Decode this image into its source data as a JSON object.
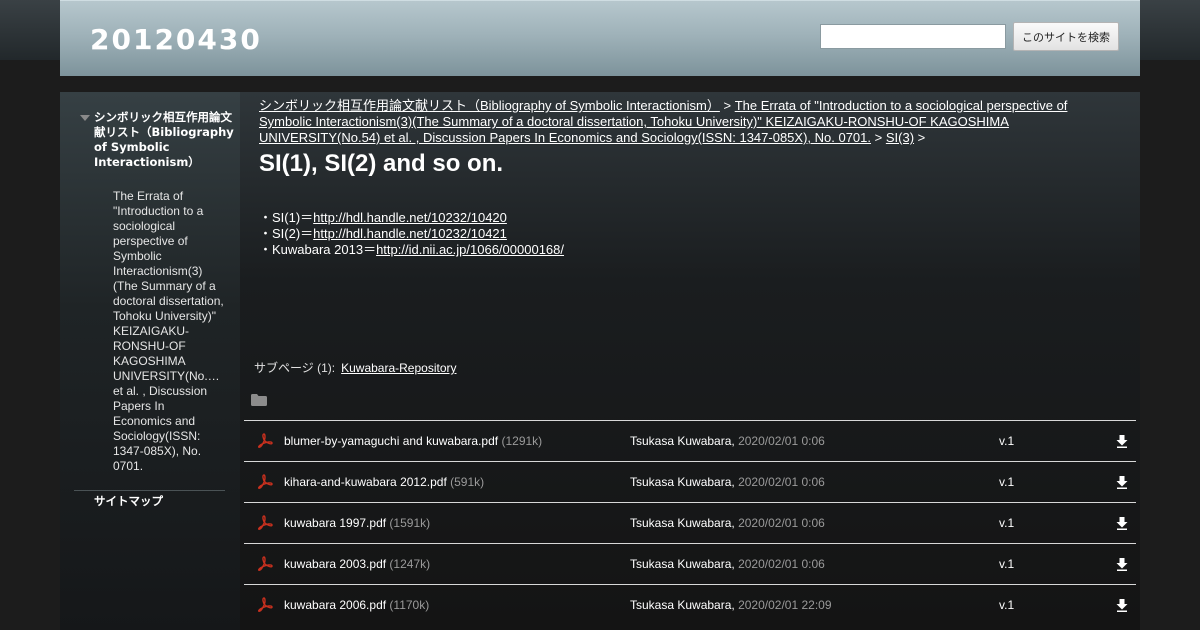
{
  "site": {
    "title": "20120430"
  },
  "search": {
    "placeholder": "",
    "button_label": "このサイトを検索"
  },
  "sidebar": {
    "top_item": "シンボリック相互作用論文献リスト（Bibliography of Symbolic Interactionism）",
    "sub_item": "The Errata of \"Introduction to a sociological perspective of Symbolic Interactionism(3)(The Summary of a doctoral dissertation, Tohoku University)\" KEIZAIGAKU-RONSHU-OF KAGOSHIMA UNIVERSITY(No.… et al. , Discussion Papers In Economics and Sociology(ISSN: 1347-085X), No. 0701.",
    "sitemap": "サイトマップ"
  },
  "breadcrumb": {
    "crumb1": "シンボリック相互作用論文献リスト（Bibliography of Symbolic Interactionism）",
    "sep": ">",
    "crumb2": "The Errata of \"Introduction to a sociological perspective of Symbolic Interactionism(3)(The Summary of a doctoral dissertation, Tohoku University)\" KEIZAIGAKU-RONSHU-OF KAGOSHIMA UNIVERSITY(No.54) et al. , Discussion Papers In Economics and Sociology(ISSN: 1347-085X), No. 0701.",
    "crumb3": "SI(3)"
  },
  "page": {
    "title": "SI(1), SI(2) and so on.",
    "lines": [
      {
        "prefix": "・SI(1)＝",
        "link": "http://hdl.handle.net/10232/10420"
      },
      {
        "prefix": "・SI(2)＝",
        "link": "http://hdl.handle.net/10232/10421"
      },
      {
        "prefix": "・Kuwabara 2013＝",
        "link": "http://id.nii.ac.jp/1066/00000168/"
      }
    ]
  },
  "subpages": {
    "label": "サブページ (1):",
    "link": "Kuwabara-Repository"
  },
  "files": [
    {
      "name": "blumer-by-yamaguchi and kuwabara.pdf",
      "size": "(1291k)",
      "author": "Tsukasa Kuwabara,",
      "date": "2020/02/01 0:06",
      "version": "v.1"
    },
    {
      "name": "kihara-and-kuwabara 2012.pdf",
      "size": "(591k)",
      "author": "Tsukasa Kuwabara,",
      "date": "2020/02/01 0:06",
      "version": "v.1"
    },
    {
      "name": "kuwabara 1997.pdf",
      "size": "(1591k)",
      "author": "Tsukasa Kuwabara,",
      "date": "2020/02/01 0:06",
      "version": "v.1"
    },
    {
      "name": "kuwabara 2003.pdf",
      "size": "(1247k)",
      "author": "Tsukasa Kuwabara,",
      "date": "2020/02/01 0:06",
      "version": "v.1"
    },
    {
      "name": "kuwabara 2006.pdf",
      "size": "(1170k)",
      "author": "Tsukasa Kuwabara,",
      "date": "2020/02/01 22:09",
      "version": "v.1"
    }
  ],
  "icons": {
    "sidebar_expand": "triangle-down-icon",
    "folder": "folder-icon",
    "file": "pdf-icon",
    "download": "download-arrow-icon"
  },
  "colors": {
    "header_bg": "#9fb2b9",
    "page_bg": "#1c1c1c",
    "pdf_red": "#c8301e"
  }
}
